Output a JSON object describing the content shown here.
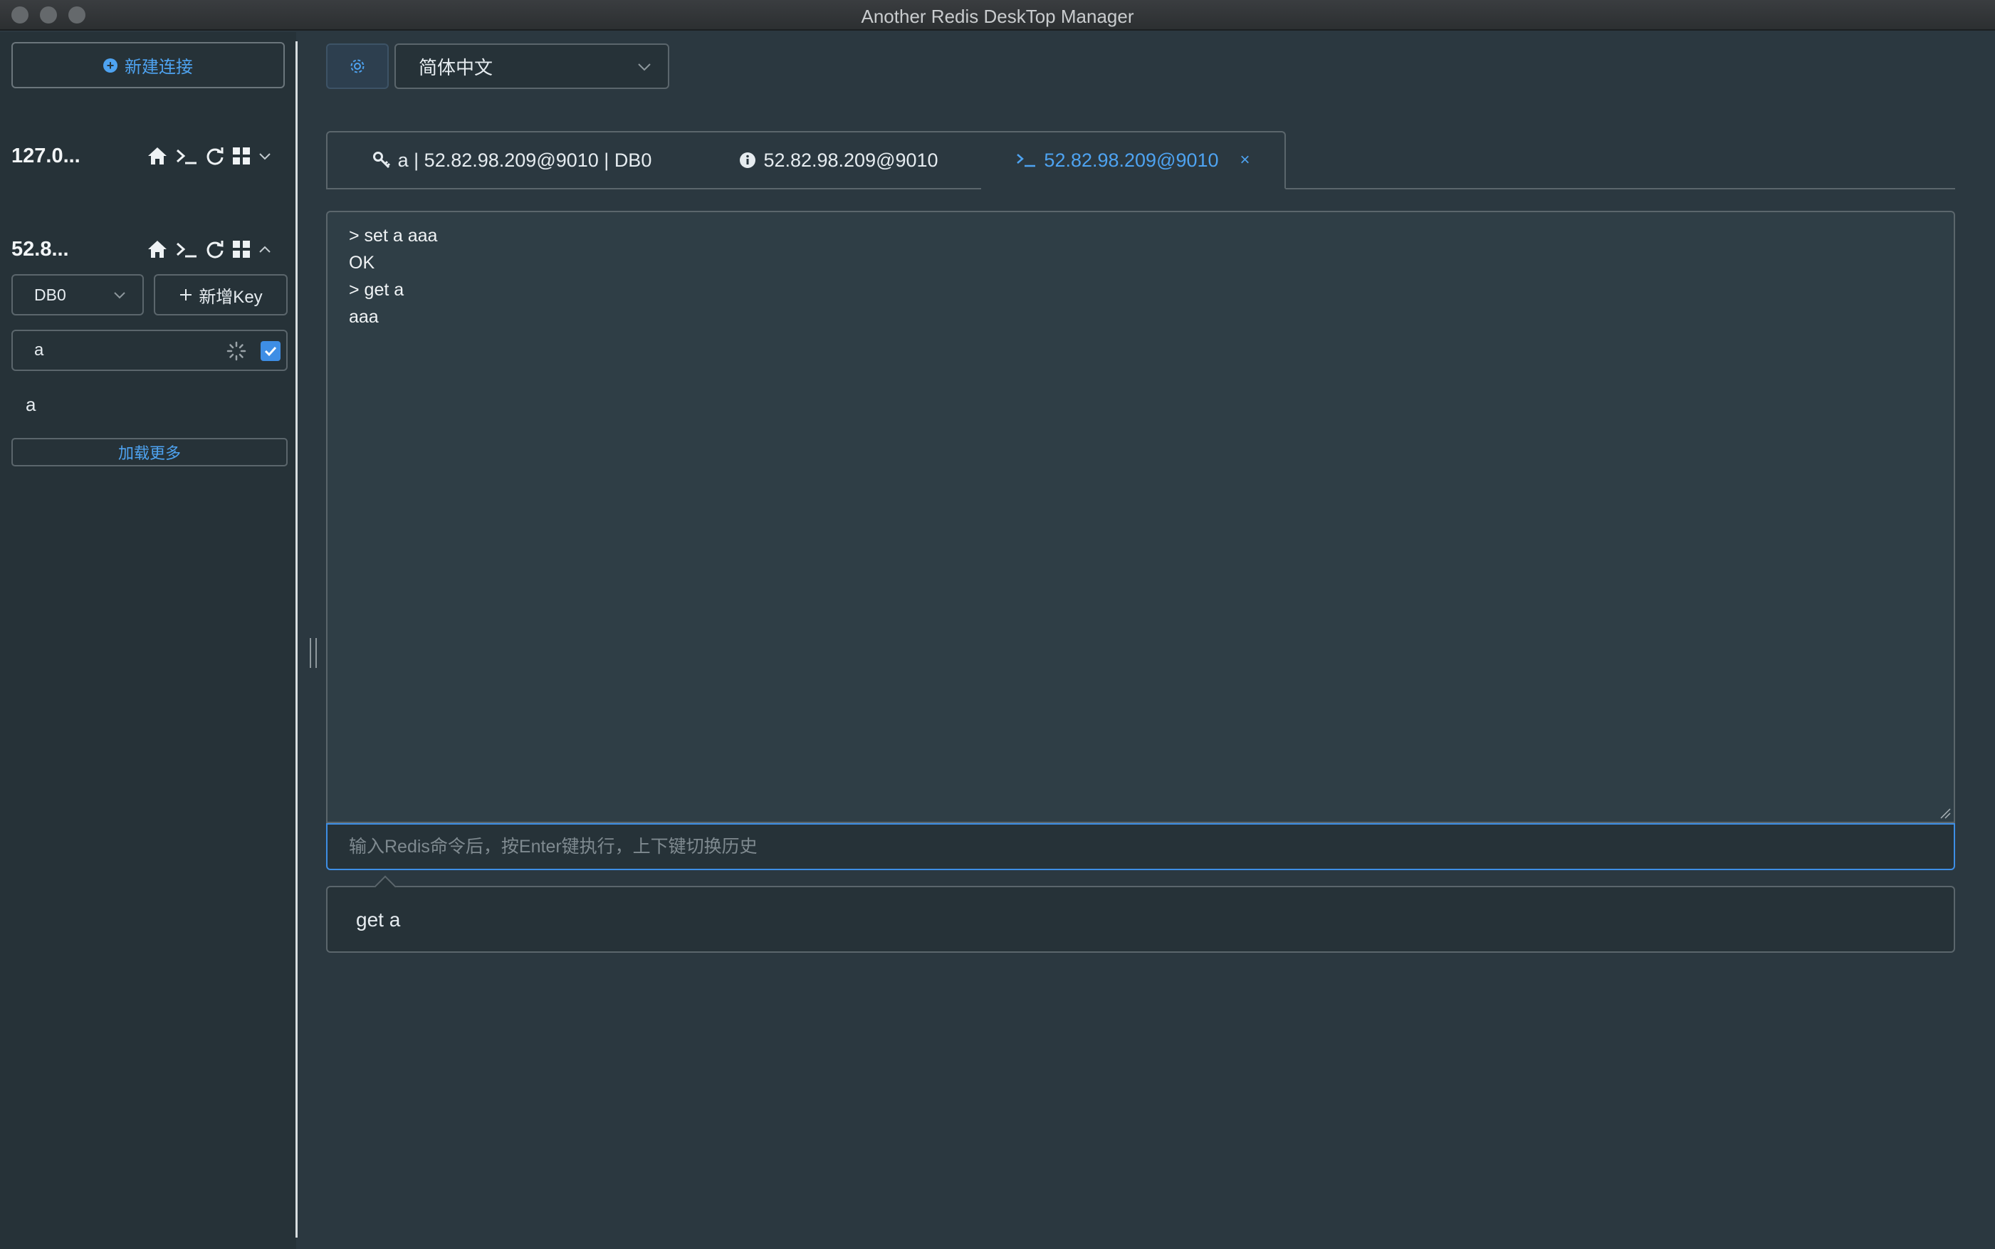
{
  "window": {
    "title": "Another Redis DeskTop Manager"
  },
  "sidebar": {
    "new_connection_label": "新建连接",
    "connections": [
      {
        "name": "127.0...",
        "expanded": false
      },
      {
        "name": "52.8...",
        "expanded": true
      }
    ],
    "db_select": "DB0",
    "new_key_label": "新增Key",
    "filter_value": "a",
    "exact_match_checked": true,
    "keys": [
      "a"
    ],
    "load_more_label": "加载更多"
  },
  "topbar": {
    "language": "简体中文"
  },
  "tabs": [
    {
      "label": "a | 52.82.98.209@9010 | DB0",
      "icon": "key-icon",
      "active": false
    },
    {
      "label": "52.82.98.209@9010",
      "icon": "info-icon",
      "active": false
    },
    {
      "label": "52.82.98.209@9010",
      "icon": "terminal-icon",
      "active": true,
      "closable": true,
      "close_glyph": "×"
    }
  ],
  "console": {
    "lines": [
      "> set a aaa",
      "OK",
      "> get a",
      "aaa"
    ],
    "input_placeholder": "输入Redis命令后，按Enter键执行，上下键切换历史",
    "input_value": "",
    "suggestions": [
      "get a"
    ]
  },
  "colors": {
    "accent": "#4ea3f1",
    "background": "#2b3840",
    "sidebar": "#263238",
    "console": "#2f3e46"
  }
}
